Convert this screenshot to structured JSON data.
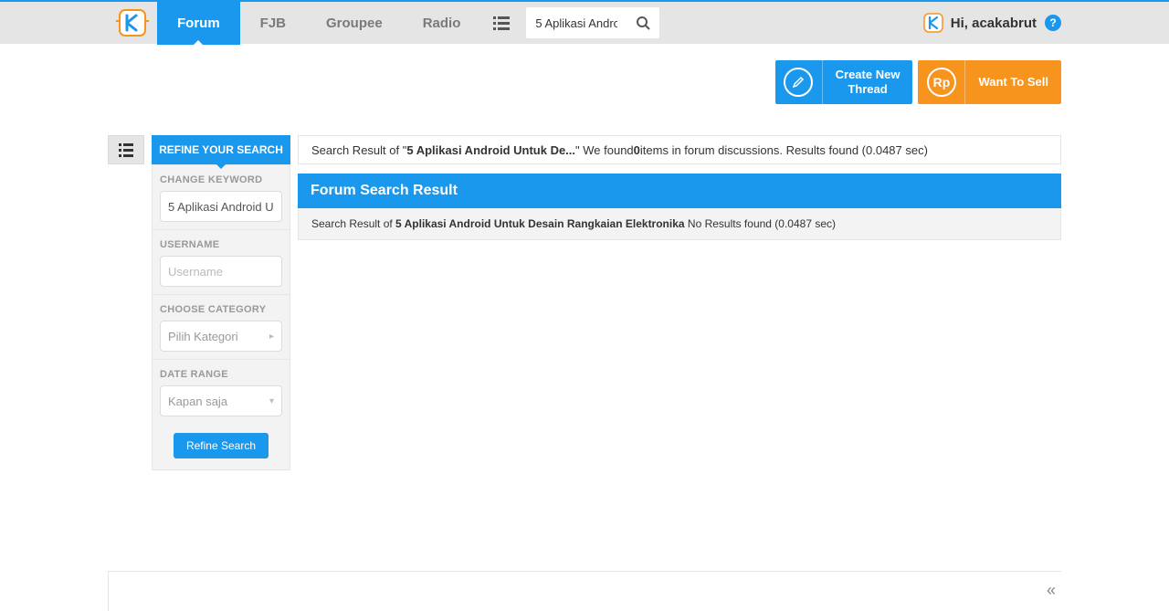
{
  "nav": {
    "forum": "Forum",
    "fjb": "FJB",
    "groupee": "Groupee",
    "radio": "Radio"
  },
  "search": {
    "value": "5 Aplikasi Andro"
  },
  "user": {
    "greeting": "Hi, acakabrut"
  },
  "actions": {
    "create_thread": "Create New\nThread",
    "want_to_sell": "Want To Sell",
    "rp_label": "Rp"
  },
  "refine": {
    "tab": "REFINE YOUR SEARCH",
    "change_keyword_label": "CHANGE KEYWORD",
    "keyword_value": "5 Aplikasi Android U",
    "username_label": "USERNAME",
    "username_placeholder": "Username",
    "category_label": "CHOOSE CATEGORY",
    "category_value": "Pilih Kategori",
    "date_label": "DATE RANGE",
    "date_value": "Kapan saja",
    "submit": "Refine Search"
  },
  "results": {
    "summary_prefix": "Search Result of \"",
    "summary_query": "5 Aplikasi Android Untuk De...",
    "summary_mid": "\" We found ",
    "summary_count": "0",
    "summary_suffix": " items in forum discussions. Results found (0.0487 sec)",
    "title": "Forum Search Result",
    "detail_prefix": "Search Result of ",
    "detail_query": "5 Aplikasi Android Untuk Desain Rangkaian Elektronika",
    "detail_suffix": " No Results found (0.0487 sec)"
  },
  "footer": {
    "collapse": "«"
  }
}
